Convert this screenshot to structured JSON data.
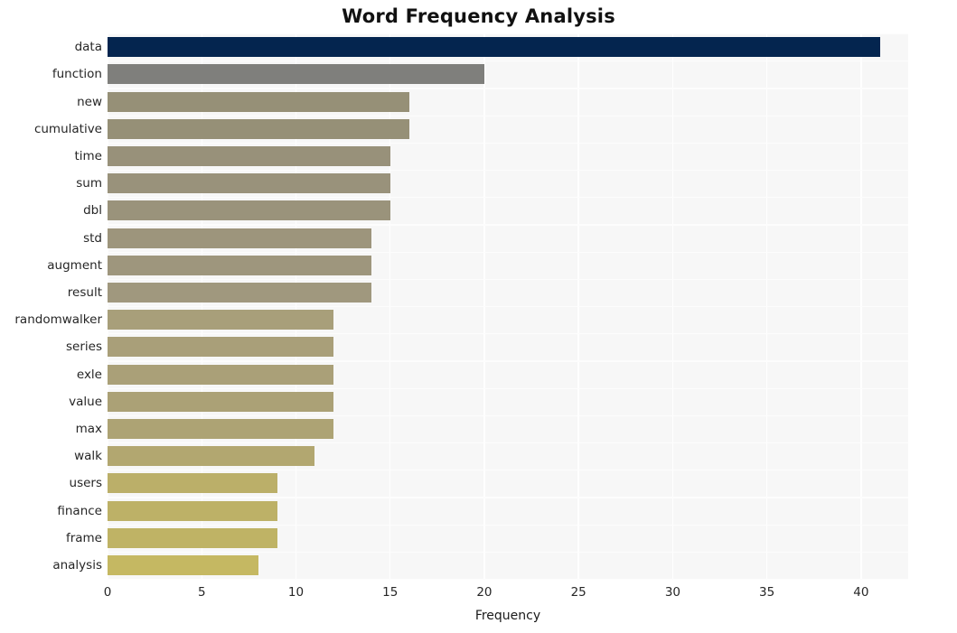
{
  "chart_data": {
    "type": "bar",
    "orientation": "horizontal",
    "title": "Word Frequency Analysis",
    "xlabel": "Frequency",
    "ylabel": "",
    "xlim": [
      0,
      42.5
    ],
    "ylim_categories_top_to_bottom": true,
    "grid": true,
    "legend": null,
    "xticks": [
      0,
      5,
      10,
      15,
      20,
      25,
      30,
      35,
      40
    ],
    "xticklabels": [
      "0",
      "5",
      "10",
      "15",
      "20",
      "25",
      "30",
      "35",
      "40"
    ],
    "categories": [
      "data",
      "function",
      "new",
      "cumulative",
      "time",
      "sum",
      "dbl",
      "std",
      "augment",
      "result",
      "randomwalker",
      "series",
      "exle",
      "value",
      "max",
      "walk",
      "users",
      "finance",
      "frame",
      "analysis"
    ],
    "values": [
      41,
      20,
      16,
      16,
      15,
      15,
      15,
      14,
      14,
      14,
      12,
      12,
      12,
      12,
      12,
      11,
      9,
      9,
      9,
      8
    ],
    "bar_colors": [
      "#04254f",
      "#7f7f7c",
      "#969077",
      "#969077",
      "#98917a",
      "#99927b",
      "#9a937b",
      "#9d957c",
      "#9e967d",
      "#a0987e",
      "#a89f7a",
      "#a99f79",
      "#aaa078",
      "#aba176",
      "#ada374",
      "#b2a770",
      "#bbaf69",
      "#bdb167",
      "#bfb365",
      "#c5b862"
    ],
    "plot_background": "#f7f7f7",
    "gridline_color": "#ffffff",
    "figure_background": "#ffffff"
  },
  "axes": {
    "title_text": "Word Frequency Analysis",
    "x_axis_title": "Frequency"
  }
}
